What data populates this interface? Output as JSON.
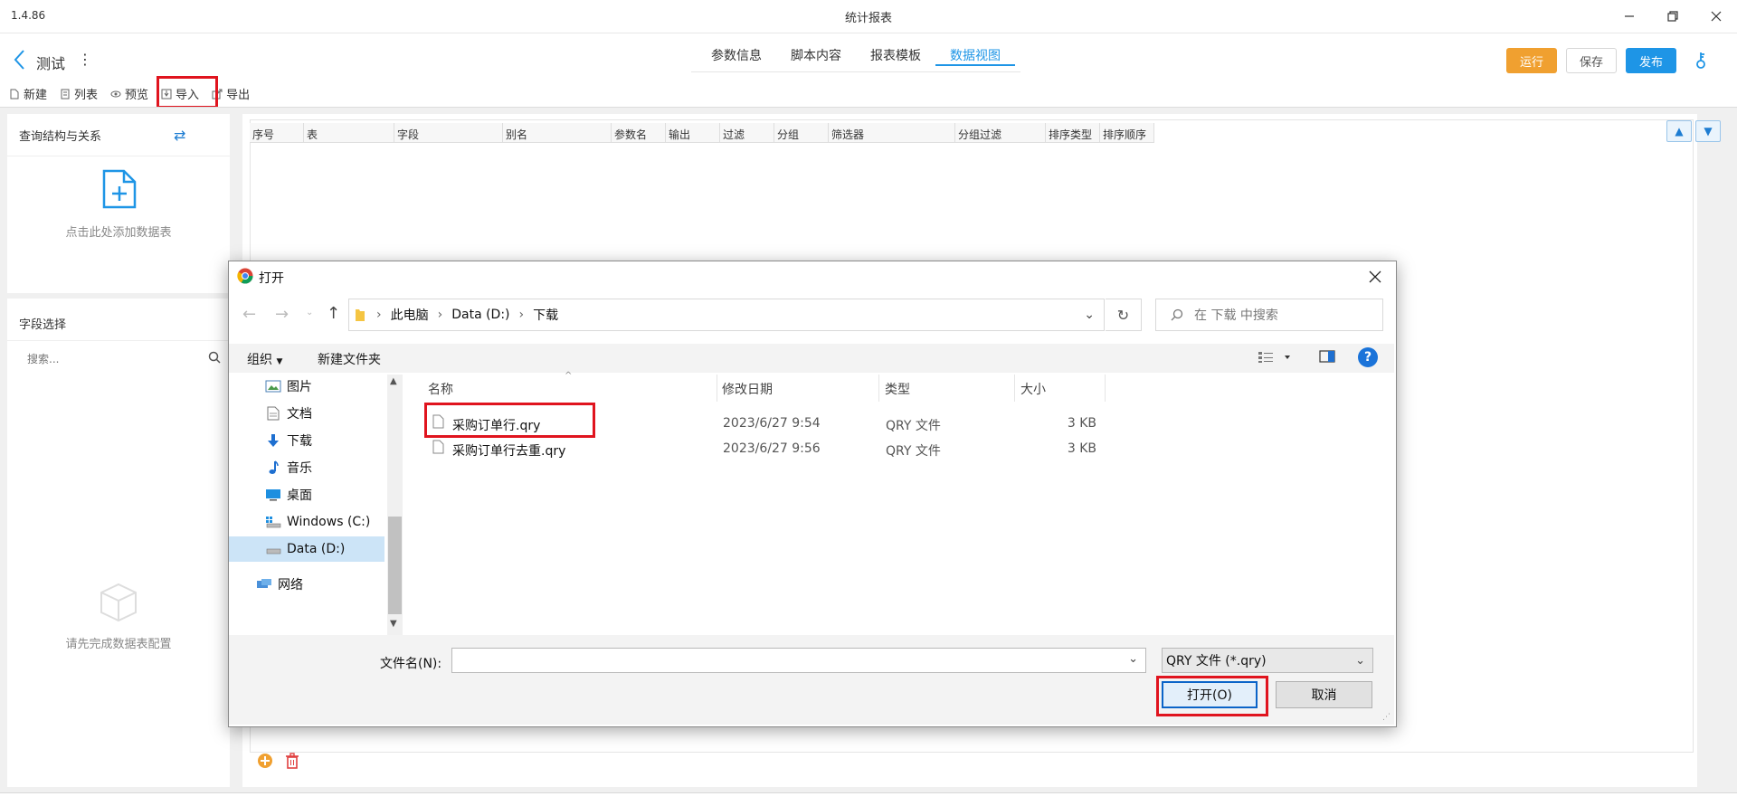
{
  "app": {
    "version": "1.4.86",
    "window_title": "统计报表"
  },
  "header": {
    "project_name": "测试",
    "tabs": [
      {
        "label": "参数信息",
        "active": false
      },
      {
        "label": "脚本内容",
        "active": false
      },
      {
        "label": "报表模板",
        "active": false
      },
      {
        "label": "数据视图",
        "active": true
      }
    ],
    "buttons": {
      "run": "运行",
      "save": "保存",
      "publish": "发布"
    }
  },
  "toolbar": {
    "new": "新建",
    "list": "列表",
    "preview": "预览",
    "import": "导入",
    "export": "导出"
  },
  "left_panel": {
    "query_title": "查询结构与关系",
    "add_table_text": "点击此处添加数据表",
    "field_title": "字段选择",
    "search_placeholder": "搜索...",
    "empty_text": "请先完成数据表配置"
  },
  "grid": {
    "columns": [
      "序号",
      "表",
      "字段",
      "别名",
      "参数名",
      "输出",
      "过滤",
      "分组",
      "筛选器",
      "分组过滤",
      "排序类型",
      "排序顺序"
    ]
  },
  "dialog": {
    "title": "打开",
    "breadcrumb": [
      "此电脑",
      "Data (D:)",
      "下载"
    ],
    "search_placeholder": "在 下载 中搜索",
    "organize": "组织",
    "new_folder": "新建文件夹",
    "tree": [
      {
        "label": "图片",
        "icon": "pictures-icon"
      },
      {
        "label": "文档",
        "icon": "documents-icon"
      },
      {
        "label": "下载",
        "icon": "downloads-icon"
      },
      {
        "label": "音乐",
        "icon": "music-icon"
      },
      {
        "label": "桌面",
        "icon": "desktop-icon"
      },
      {
        "label": "Windows (C:)",
        "icon": "drive-icon"
      },
      {
        "label": "Data (D:)",
        "icon": "drive-icon",
        "selected": true
      },
      {
        "label": "网络",
        "icon": "network-icon"
      }
    ],
    "columns": {
      "name": "名称",
      "modified": "修改日期",
      "type": "类型",
      "size": "大小"
    },
    "files": [
      {
        "name": "采购订单行.qry",
        "modified": "2023/6/27 9:54",
        "type": "QRY 文件",
        "size": "3 KB"
      },
      {
        "name": "采购订单行去重.qry",
        "modified": "2023/6/27 9:56",
        "type": "QRY 文件",
        "size": "3 KB"
      }
    ],
    "filename_label": "文件名(N):",
    "filename_value": "",
    "file_type_filter": "QRY 文件 (*.qry)",
    "open_button": "打开(O)",
    "cancel_button": "取消"
  },
  "colors": {
    "accent_blue": "#1e95e6",
    "run_orange": "#f0a030",
    "highlight_red": "#e0141e"
  }
}
